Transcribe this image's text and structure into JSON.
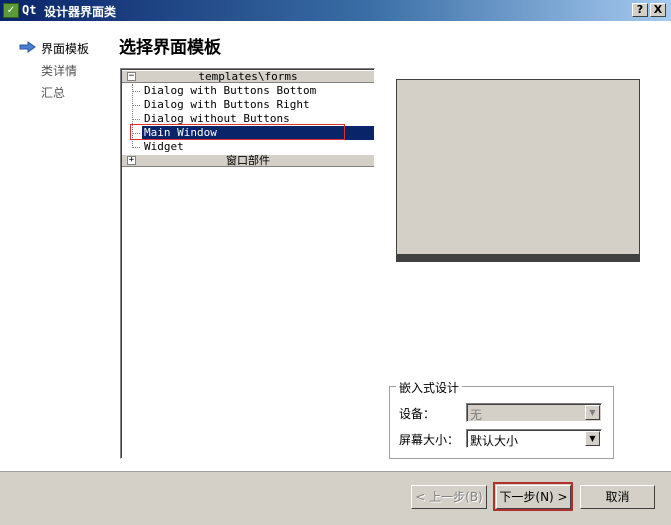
{
  "window": {
    "app_name": "Qt",
    "title": "设计器界面类",
    "help_button": "?",
    "close_button": "X"
  },
  "steps": [
    {
      "label": "界面模板",
      "active": true
    },
    {
      "label": "类详情",
      "active": false
    },
    {
      "label": "汇总",
      "active": false
    }
  ],
  "page_title": "选择界面模板",
  "tree": {
    "category1": {
      "label": "templates\\forms",
      "expander": "−"
    },
    "items": [
      "Dialog with Buttons Bottom",
      "Dialog with Buttons Right",
      "Dialog without Buttons",
      "Main Window",
      "Widget"
    ],
    "selected_item": "Main Window",
    "category2": {
      "label": "窗口部件",
      "expander": "+"
    }
  },
  "embedded": {
    "title": "嵌入式设计",
    "device_label": "设备：",
    "device_value": "无",
    "screen_label": "屏幕大小：",
    "screen_value": "默认大小"
  },
  "buttons": {
    "back": "< 上一步(B)",
    "next": "下一步(N) >",
    "cancel": "取消"
  },
  "icons": {
    "step_arrow": "arrow-right-icon",
    "dropdown": "chevron-down-icon"
  },
  "colors": {
    "selection": "#0a246a",
    "highlight_box": "#e03030",
    "face": "#d4d0c8"
  }
}
